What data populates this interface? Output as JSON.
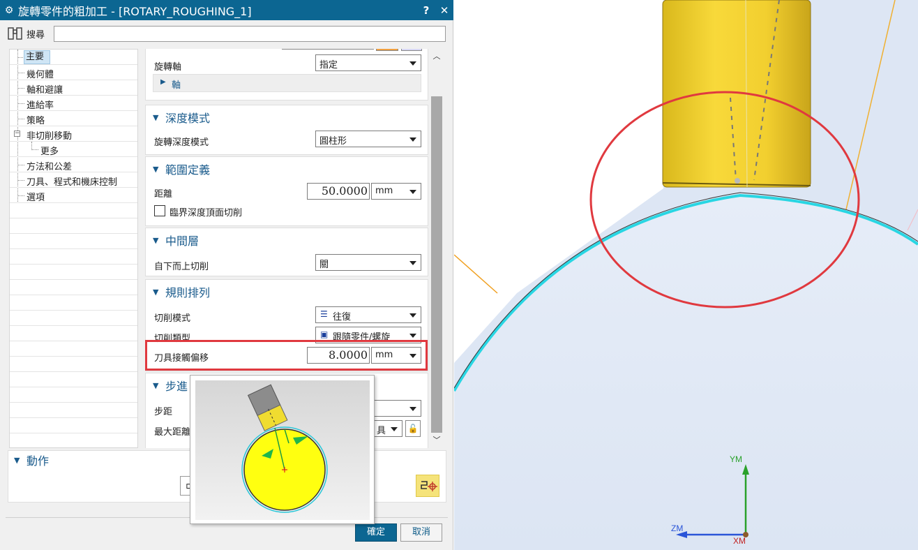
{
  "dialog": {
    "title": "旋轉零件的粗加工 - [ROTARY_ROUGHING_1]",
    "help_label": "?",
    "close_label": "✕"
  },
  "search": {
    "label": "搜尋",
    "value": ""
  },
  "tree": {
    "items": [
      {
        "label": "主要",
        "selected": true
      },
      {
        "label": "幾何體"
      },
      {
        "label": "軸和避讓"
      },
      {
        "label": "進給率"
      },
      {
        "label": "策略"
      },
      {
        "label": "非切削移動",
        "expanded": true
      },
      {
        "label": "更多"
      },
      {
        "label": "方法和公差"
      },
      {
        "label": "刀具、程式和機床控制"
      },
      {
        "label": "選項"
      }
    ],
    "collapse_glyph": "−"
  },
  "panel": {
    "rotation_axis": {
      "label": "旋轉軸",
      "value": "指定"
    },
    "axis_group": {
      "label": "軸"
    },
    "depth_mode": {
      "header": "深度模式",
      "field_label": "旋轉深度模式",
      "value": "圓柱形"
    },
    "range": {
      "header": "範圍定義",
      "distance_label": "距離",
      "distance_value": "50.0000",
      "distance_unit": "mm",
      "checkbox_label": "臨界深度頂面切削"
    },
    "middle": {
      "header": "中間層",
      "field_label": "自下而上切削",
      "value": "關"
    },
    "pattern": {
      "header": "規則排列",
      "cut_mode_label": "切削模式",
      "cut_mode_value": "往復",
      "cut_type_label": "切削類型",
      "cut_type_value": "跟隨零件/螺旋",
      "contact_offset_label": "刀具接觸偏移",
      "contact_offset_value": "8.0000",
      "contact_offset_unit": "mm"
    },
    "stepover": {
      "header": "步進",
      "step_label": "步距",
      "max_dist_label": "最大距離",
      "max_dist_value": "具"
    }
  },
  "actions": {
    "header": "動作"
  },
  "buttons": {
    "ok": "確定",
    "cancel": "取消"
  },
  "viewport": {
    "axis_y": "YM",
    "axis_z": "ZM",
    "axis_x": "XM"
  },
  "colors": {
    "title_bar": "#0c6692",
    "section_header": "#1a5b8c",
    "highlight_red": "#e0393f",
    "tool_yellow": "#f2cf2f",
    "part_edge_cyan": "#29d6e3"
  }
}
